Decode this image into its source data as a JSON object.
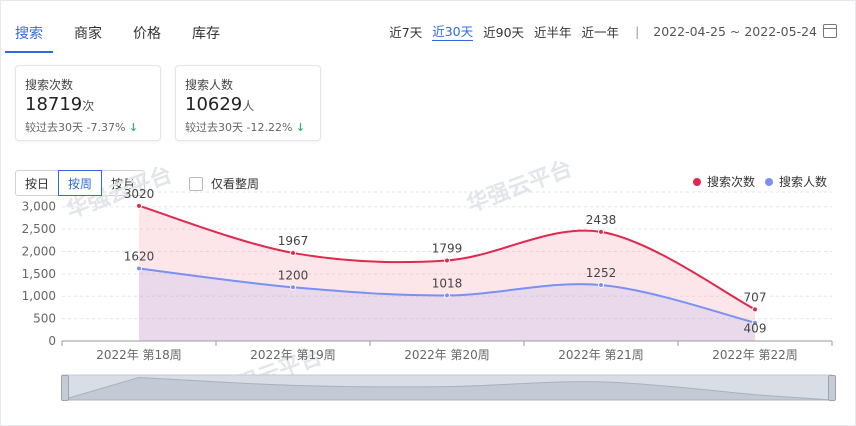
{
  "tabs": [
    {
      "label": "搜索",
      "active": true
    },
    {
      "label": "商家",
      "active": false
    },
    {
      "label": "价格",
      "active": false
    },
    {
      "label": "库存",
      "active": false
    }
  ],
  "ranges": [
    {
      "label": "近7天",
      "active": false
    },
    {
      "label": "近30天",
      "active": true
    },
    {
      "label": "近90天",
      "active": false
    },
    {
      "label": "近半年",
      "active": false
    },
    {
      "label": "近一年",
      "active": false
    }
  ],
  "separator": "|",
  "date_range": "2022-04-25 ~ 2022-05-24",
  "stats": [
    {
      "label": "搜索次数",
      "value": "18719",
      "unit": "次",
      "compare": "较过去30天",
      "change": "-7.37%"
    },
    {
      "label": "搜索人数",
      "value": "10629",
      "unit": "人",
      "compare": "较过去30天",
      "change": "-12.22%"
    }
  ],
  "granularity": [
    {
      "label": "按日",
      "active": false
    },
    {
      "label": "按周",
      "active": true
    },
    {
      "label": "按月",
      "active": false
    }
  ],
  "checkbox_label": "仅看整周",
  "colors": {
    "accent": "#2f6bde",
    "series1": "#e0294d",
    "series2": "#7891f2",
    "down": "#3cb371"
  },
  "watermark": "华强云平台",
  "chart_data": {
    "type": "line",
    "categories": [
      "2022年 第18周",
      "2022年 第19周",
      "2022年 第20周",
      "2022年 第21周",
      "2022年 第22周"
    ],
    "series": [
      {
        "name": "搜索次数",
        "values": [
          3020,
          1967,
          1799,
          2438,
          707
        ]
      },
      {
        "name": "搜索人数",
        "values": [
          1620,
          1200,
          1018,
          1252,
          409
        ]
      }
    ],
    "yticks": [
      "0",
      "500",
      "1,000",
      "1,500",
      "2,000",
      "2,500",
      "3,000"
    ],
    "ylim": [
      0,
      3000
    ],
    "grid": true,
    "legend_position": "top-right",
    "area": true,
    "title": "",
    "xlabel": "",
    "ylabel": ""
  }
}
